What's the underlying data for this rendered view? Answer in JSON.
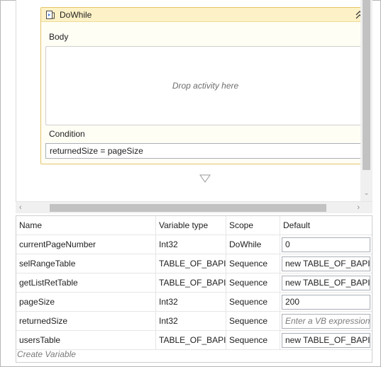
{
  "activity": {
    "title": "DoWhile",
    "body_label": "Body",
    "drop_placeholder": "Drop activity here",
    "condition_label": "Condition",
    "condition_value": "returnedSize = pageSize"
  },
  "icons": {
    "activity_icon": "dowhile-icon",
    "collapse": "double-chevron-up-icon",
    "connector": "triangle-down-icon",
    "scroll_left": "chevron-left-icon",
    "scroll_right": "chevron-right-icon",
    "scroll_down": "chevron-down-icon"
  },
  "variables": {
    "columns": [
      "Name",
      "Variable type",
      "Scope",
      "Default"
    ],
    "rows": [
      {
        "name": "currentPageNumber",
        "type": "Int32",
        "scope": "DoWhile",
        "default": "0",
        "placeholder": ""
      },
      {
        "name": "selRangeTable",
        "type": "TABLE_OF_BAPIUS",
        "scope": "Sequence",
        "default": "new TABLE_OF_BAPIUS",
        "placeholder": ""
      },
      {
        "name": "getListRetTable",
        "type": "TABLE_OF_BAPIRET",
        "scope": "Sequence",
        "default": "new TABLE_OF_BAPIRI",
        "placeholder": ""
      },
      {
        "name": "pageSize",
        "type": "Int32",
        "scope": "Sequence",
        "default": "200",
        "placeholder": ""
      },
      {
        "name": "returnedSize",
        "type": "Int32",
        "scope": "Sequence",
        "default": "",
        "placeholder": "Enter a VB expression"
      },
      {
        "name": "usersTable",
        "type": "TABLE_OF_BAPIUS",
        "scope": "Sequence",
        "default": "new TABLE_OF_BAPIUS",
        "placeholder": ""
      }
    ],
    "create_label": "Create Variable"
  },
  "colors": {
    "header_bg": "#fdf1c7",
    "activity_border": "#e3c46a"
  }
}
